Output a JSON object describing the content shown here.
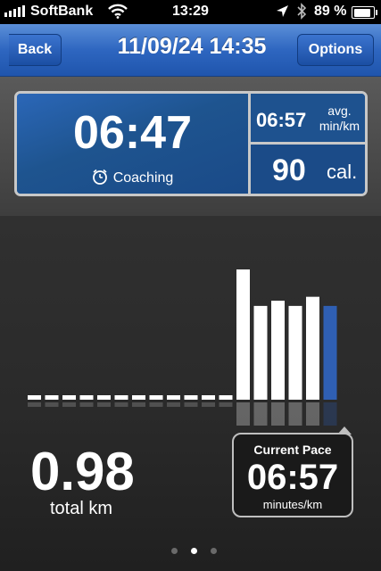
{
  "status_bar": {
    "carrier": "SoftBank",
    "time": "13:29",
    "battery": "89 %",
    "battery_level": 0.89
  },
  "nav": {
    "back_label": "Back",
    "title": "11/09/24 14:35",
    "options_label": "Options"
  },
  "stats": {
    "time": "06:47",
    "coaching_label": "Coaching",
    "avg_pace": "06:57",
    "avg_pace_unit_line1": "avg.",
    "avg_pace_unit_line2": "min/km",
    "calories": "90",
    "calories_unit": "cal."
  },
  "summary": {
    "total_value": "0.98",
    "total_label": "total km"
  },
  "current_pace": {
    "title": "Current Pace",
    "value": "06:57",
    "unit": "minutes/km"
  },
  "pager": {
    "count": 3,
    "active": 1
  },
  "colors": {
    "bar": "#ffffff",
    "highlight_bar": "#2f5fb3",
    "nav_blue": "#2e66c0"
  },
  "chart_data": {
    "type": "bar",
    "values": [
      0,
      0,
      0,
      0,
      0,
      0,
      0,
      0,
      0,
      0,
      0,
      0,
      1.0,
      0.72,
      0.76,
      0.72,
      0.79,
      0.72
    ],
    "highlight_index": 17,
    "ylim": [
      0,
      1
    ]
  }
}
